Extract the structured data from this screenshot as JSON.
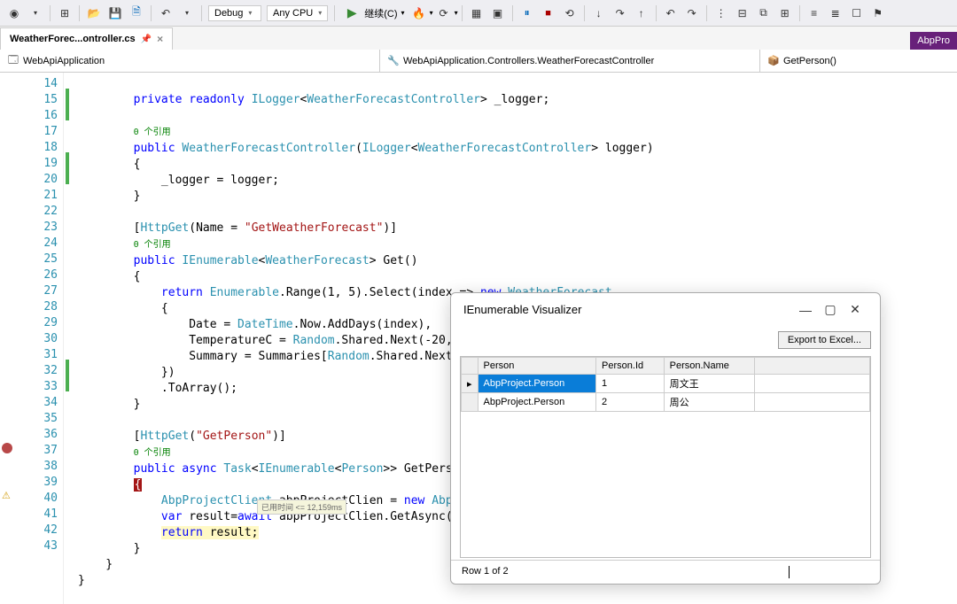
{
  "toolbar": {
    "config": "Debug",
    "platform": "Any CPU",
    "continue": "继续(C)"
  },
  "tab": {
    "name": "WeatherForec...ontroller.cs"
  },
  "right_tab": "AbpPro",
  "nav": {
    "scope": "WebApiApplication",
    "class": "WebApiApplication.Controllers.WeatherForecastController",
    "method": "GetPerson()"
  },
  "lines": [
    "14",
    "15",
    "16",
    "17",
    "18",
    "19",
    "20",
    "21",
    "22",
    "23",
    "24",
    "25",
    "26",
    "27",
    "28",
    "29",
    "30",
    "31",
    "32",
    "33",
    "34",
    "35",
    "36",
    "37",
    "38",
    "39",
    "40",
    "41",
    "42",
    "43"
  ],
  "refs": "0 个引用",
  "tooltip": "已用时间 <= 12,159ms",
  "visualizer": {
    "title": "IEnumerable Visualizer",
    "export": "Export to Excel...",
    "cols": [
      "Person",
      "Person.Id",
      "Person.Name"
    ],
    "rows": [
      {
        "p": "AbpProject.Person",
        "id": "1",
        "name": "周文王"
      },
      {
        "p": "AbpProject.Person",
        "id": "2",
        "name": "周公"
      }
    ],
    "status": "Row 1 of 2"
  }
}
